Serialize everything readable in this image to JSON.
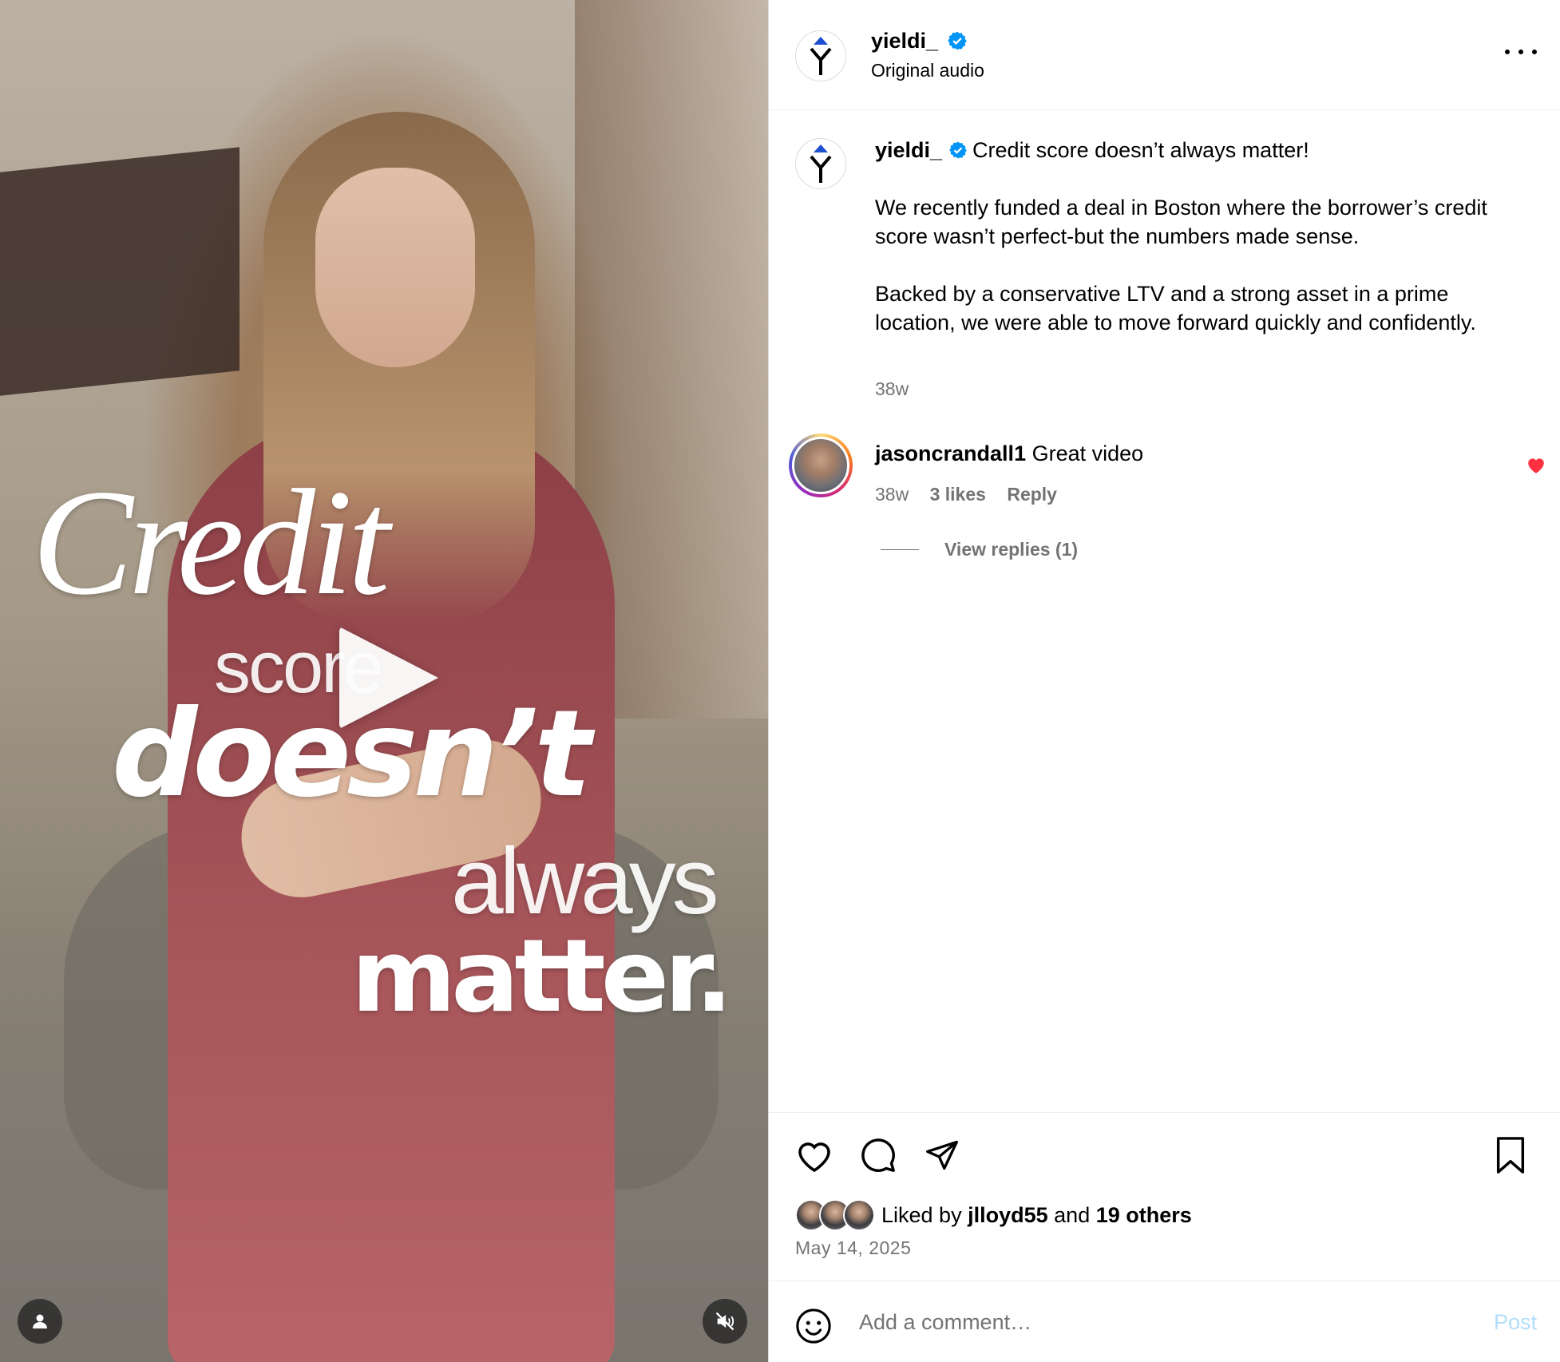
{
  "video": {
    "overlay_lines": [
      "Credit",
      "score",
      "doesn’t",
      "always",
      "matter."
    ],
    "play_icon": "play-icon",
    "user_icon": "user-icon",
    "mute_icon": "muted-speaker-icon"
  },
  "header": {
    "username": "yieldi_",
    "audio": "Original audio",
    "logo_letter": "Y"
  },
  "caption": {
    "username": "yieldi_",
    "headline": "Credit score doesn’t always matter!",
    "paragraph1": "We recently funded a deal in Boston where the borrower’s credit score wasn’t perfect-but the numbers made sense.",
    "paragraph2": "Backed by a conservative LTV and a strong asset in a prime location, we were able to move forward quickly and confidently.",
    "time": "38w"
  },
  "comment": {
    "username": "jasoncrandall1",
    "text": "Great video",
    "time": "38w",
    "likes": "3 likes",
    "reply": "Reply",
    "view_replies": "View replies (1)"
  },
  "likes": {
    "prefix": "Liked by",
    "user": "jlloyd55",
    "joiner": "and",
    "others": "19 others"
  },
  "post_date": "May 14, 2025",
  "comment_box": {
    "placeholder": "Add a comment…",
    "post_label": "Post"
  },
  "colors": {
    "verified": "#0095f6",
    "heart": "#ff3040",
    "post_disabled": "#b2dffc",
    "secondary_text": "#737373",
    "logo_blue": "#1f4fd1"
  }
}
